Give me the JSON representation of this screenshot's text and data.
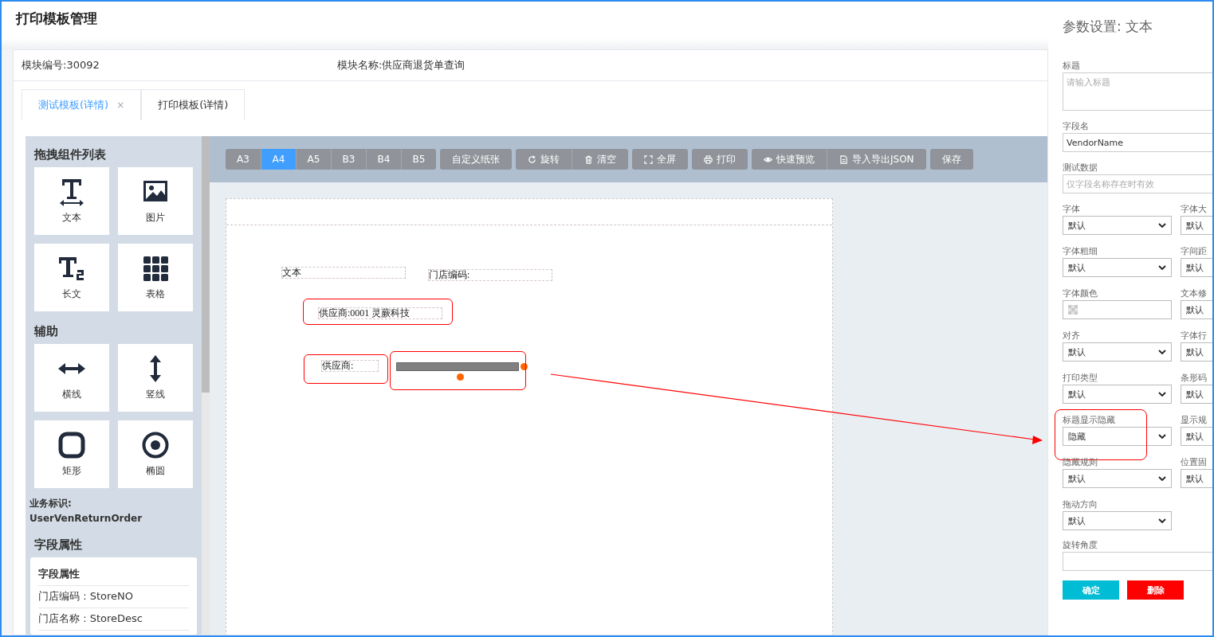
{
  "page_title": "打印模板管理",
  "module_info": {
    "number": "模块编号:30092",
    "name": "模块名称:供应商退货单查询"
  },
  "tabs": [
    {
      "label": "测试模板(详情)",
      "selected": true,
      "close": "×"
    },
    {
      "label": "打印模板(详情)",
      "selected": false
    }
  ],
  "component_panel": {
    "title": "拖拽组件列表",
    "items": [
      {
        "label": "文本",
        "kind": "text"
      },
      {
        "label": "图片",
        "kind": "image"
      },
      {
        "label": "长文",
        "kind": "longtext"
      },
      {
        "label": "表格",
        "kind": "table"
      }
    ],
    "aux_title": "辅助",
    "aux_items": [
      {
        "label": "横线",
        "kind": "hline"
      },
      {
        "label": "竖线",
        "kind": "vline"
      },
      {
        "label": "矩形",
        "kind": "rect"
      },
      {
        "label": "椭圆",
        "kind": "ellipse"
      }
    ],
    "business_id_label": "业务标识:",
    "business_id": "UserVenReturnOrder",
    "fields_title": "字段属性",
    "fields_card": {
      "title": "字段属性",
      "rows": [
        "门店编码 : StoreNO",
        "门店名称 : StoreDesc"
      ]
    }
  },
  "toolbar": {
    "paper_sizes": [
      {
        "label": "A3",
        "selected": false
      },
      {
        "label": "A4",
        "selected": true
      },
      {
        "label": "A5",
        "selected": false
      },
      {
        "label": "B3",
        "selected": false
      },
      {
        "label": "B4",
        "selected": false
      },
      {
        "label": "B5",
        "selected": false
      }
    ],
    "groups": [
      [
        {
          "label": "自定义纸张",
          "kind": "plain"
        }
      ],
      [
        {
          "label": "旋转",
          "kind": "rotate"
        },
        {
          "label": "清空",
          "kind": "trash"
        }
      ],
      [
        {
          "label": "全屏",
          "kind": "fullscreen"
        }
      ],
      [
        {
          "label": "打印",
          "kind": "print"
        }
      ],
      [
        {
          "label": "快速预览",
          "kind": "eye"
        },
        {
          "label": "导入导出JSON",
          "kind": "file"
        }
      ],
      [
        {
          "label": "保存",
          "kind": "plain"
        }
      ]
    ]
  },
  "canvas": {
    "elements": [
      {
        "kind": "text",
        "text": "文本",
        "highlighted": false
      },
      {
        "kind": "text",
        "text": "门店编码:",
        "highlighted": false
      },
      {
        "kind": "text",
        "text": "供应商:0001 灵蕨科技",
        "highlighted": true
      },
      {
        "kind": "text",
        "text": "供应商:",
        "highlighted": true
      },
      {
        "kind": "bar",
        "highlighted": true,
        "selected": true
      }
    ]
  },
  "settings": {
    "title": "参数设置: 文本",
    "title_field": {
      "label": "标题",
      "placeholder": "请输入标题"
    },
    "field_name": {
      "label": "字段名",
      "value": "VendorName"
    },
    "test_data": {
      "label": "测试数据",
      "placeholder": "仅字段名称存在时有效"
    },
    "grid": [
      {
        "label": "字体",
        "kind": "select",
        "value": "默认",
        "highlighted": false
      },
      {
        "label": "字体大",
        "kind": "select",
        "value": "默认",
        "highlighted": false
      },
      {
        "label": "字体粗细",
        "kind": "select",
        "value": "默认",
        "highlighted": false
      },
      {
        "label": "字间距",
        "kind": "select",
        "value": "默认",
        "highlighted": false
      },
      {
        "label": "字体颜色",
        "kind": "color",
        "highlighted": false
      },
      {
        "label": "文本修",
        "kind": "select",
        "value": "默认",
        "highlighted": false
      },
      {
        "label": "对齐",
        "kind": "select",
        "value": "默认",
        "highlighted": false
      },
      {
        "label": "字体行",
        "kind": "select",
        "value": "默认",
        "highlighted": false
      },
      {
        "label": "打印类型",
        "kind": "select",
        "value": "默认",
        "highlighted": false
      },
      {
        "label": "条形码",
        "kind": "select",
        "value": "默认",
        "highlighted": false
      },
      {
        "label": "标题显示隐藏",
        "kind": "select",
        "value": "隐藏",
        "highlighted": true
      },
      {
        "label": "显示规",
        "kind": "select",
        "value": "默认",
        "highlighted": false
      },
      {
        "label": "隐藏规则",
        "kind": "select",
        "value": "默认",
        "highlighted": false
      },
      {
        "label": "位置固",
        "kind": "select",
        "value": "默认",
        "highlighted": false
      },
      {
        "label": "拖动方向",
        "kind": "select",
        "value": "默认",
        "highlighted": false
      }
    ],
    "rotation": {
      "label": "旋转角度"
    },
    "buttons": [
      {
        "label": "确定",
        "kind": "confirm"
      },
      {
        "label": "删除",
        "kind": "danger"
      }
    ]
  }
}
